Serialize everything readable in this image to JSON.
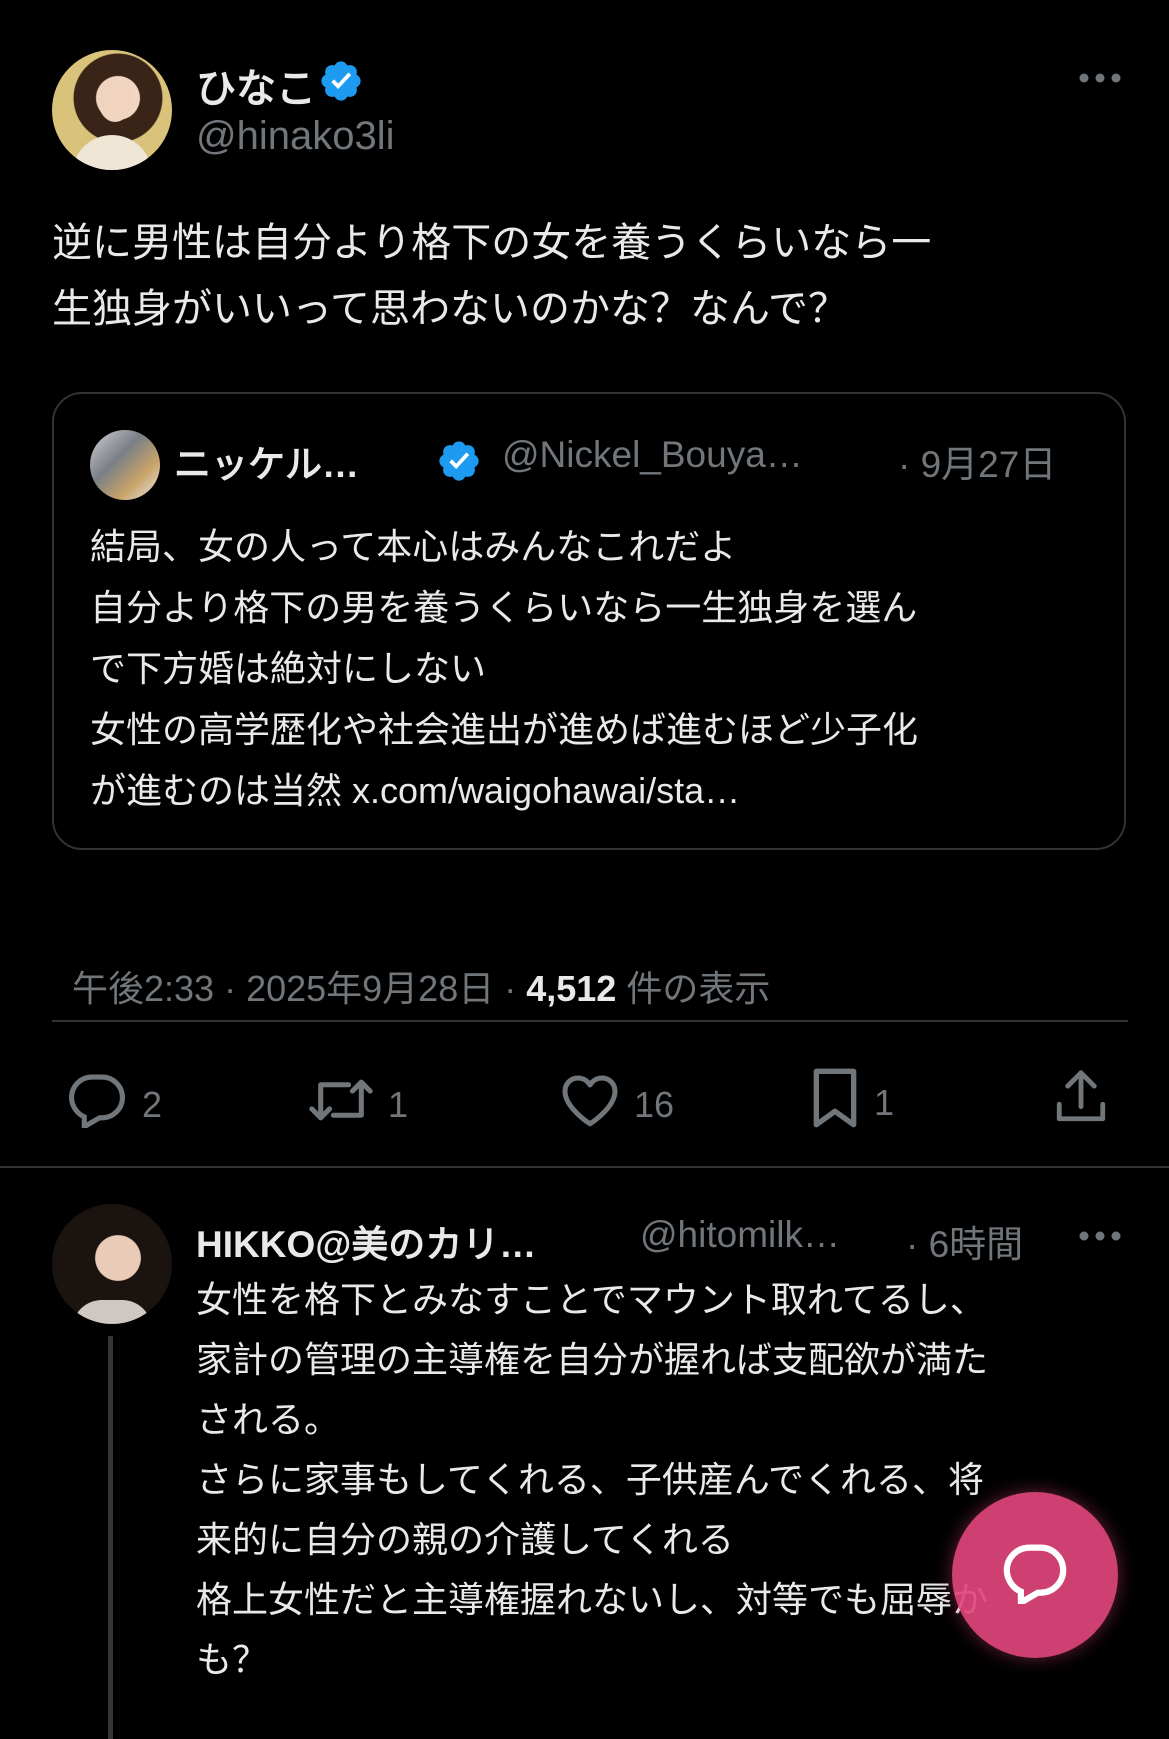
{
  "tweet": {
    "display_name": "ひなこ",
    "handle": "@hinako3li",
    "text": "逆に男性は自分より格下の女を養うくらいなら一\n生独身がいいって思わないのかな？なんで？",
    "timestamp": "午後2:33 · 2025年9月28日 · ",
    "views_count": "4,512",
    "views_label": " 件の表示"
  },
  "quote": {
    "display_name": "ニッケル…",
    "handle": "@Nickel_Bouya…",
    "time": "· 9月27日",
    "text": "結局、女の人って本心はみんなこれだよ\n自分より格下の男を養うくらいなら一生独身を選ん\nで下方婚は絶対にしない\n女性の高学歴化や社会進出が進めば進むほど少子化\nが進むのは当然 x.com/waigohawai/sta…"
  },
  "actions": {
    "reply_count": "2",
    "retweet_count": "1",
    "like_count": "16",
    "bookmark_count": "1"
  },
  "reply": {
    "display_name": "HIKKO@美のカリ…",
    "handle": "@hitomilk…",
    "time": "· 6時間",
    "text": "女性を格下とみなすことでマウント取れてるし、\n家計の管理の主導権を自分が握れば支配欲が満た\nされる。\nさらに家事もしてくれる、子供産んでくれる、将\n来的に自分の親の介護してくれる\n格上女性だと主導権握れないし、対等でも屈辱か\nも？"
  },
  "colors": {
    "background": "#000000",
    "text": "#e7e9ea",
    "muted": "#71767b",
    "verified": "#1d9bf0",
    "fab": "#e0457b",
    "border": "#2f3336"
  },
  "icons": {
    "verified": "verified-badge-icon",
    "more": "more-dots-icon",
    "reply": "reply-icon",
    "retweet": "retweet-icon",
    "like": "heart-icon",
    "bookmark": "bookmark-icon",
    "share": "share-icon",
    "compose": "compose-reply-icon"
  }
}
